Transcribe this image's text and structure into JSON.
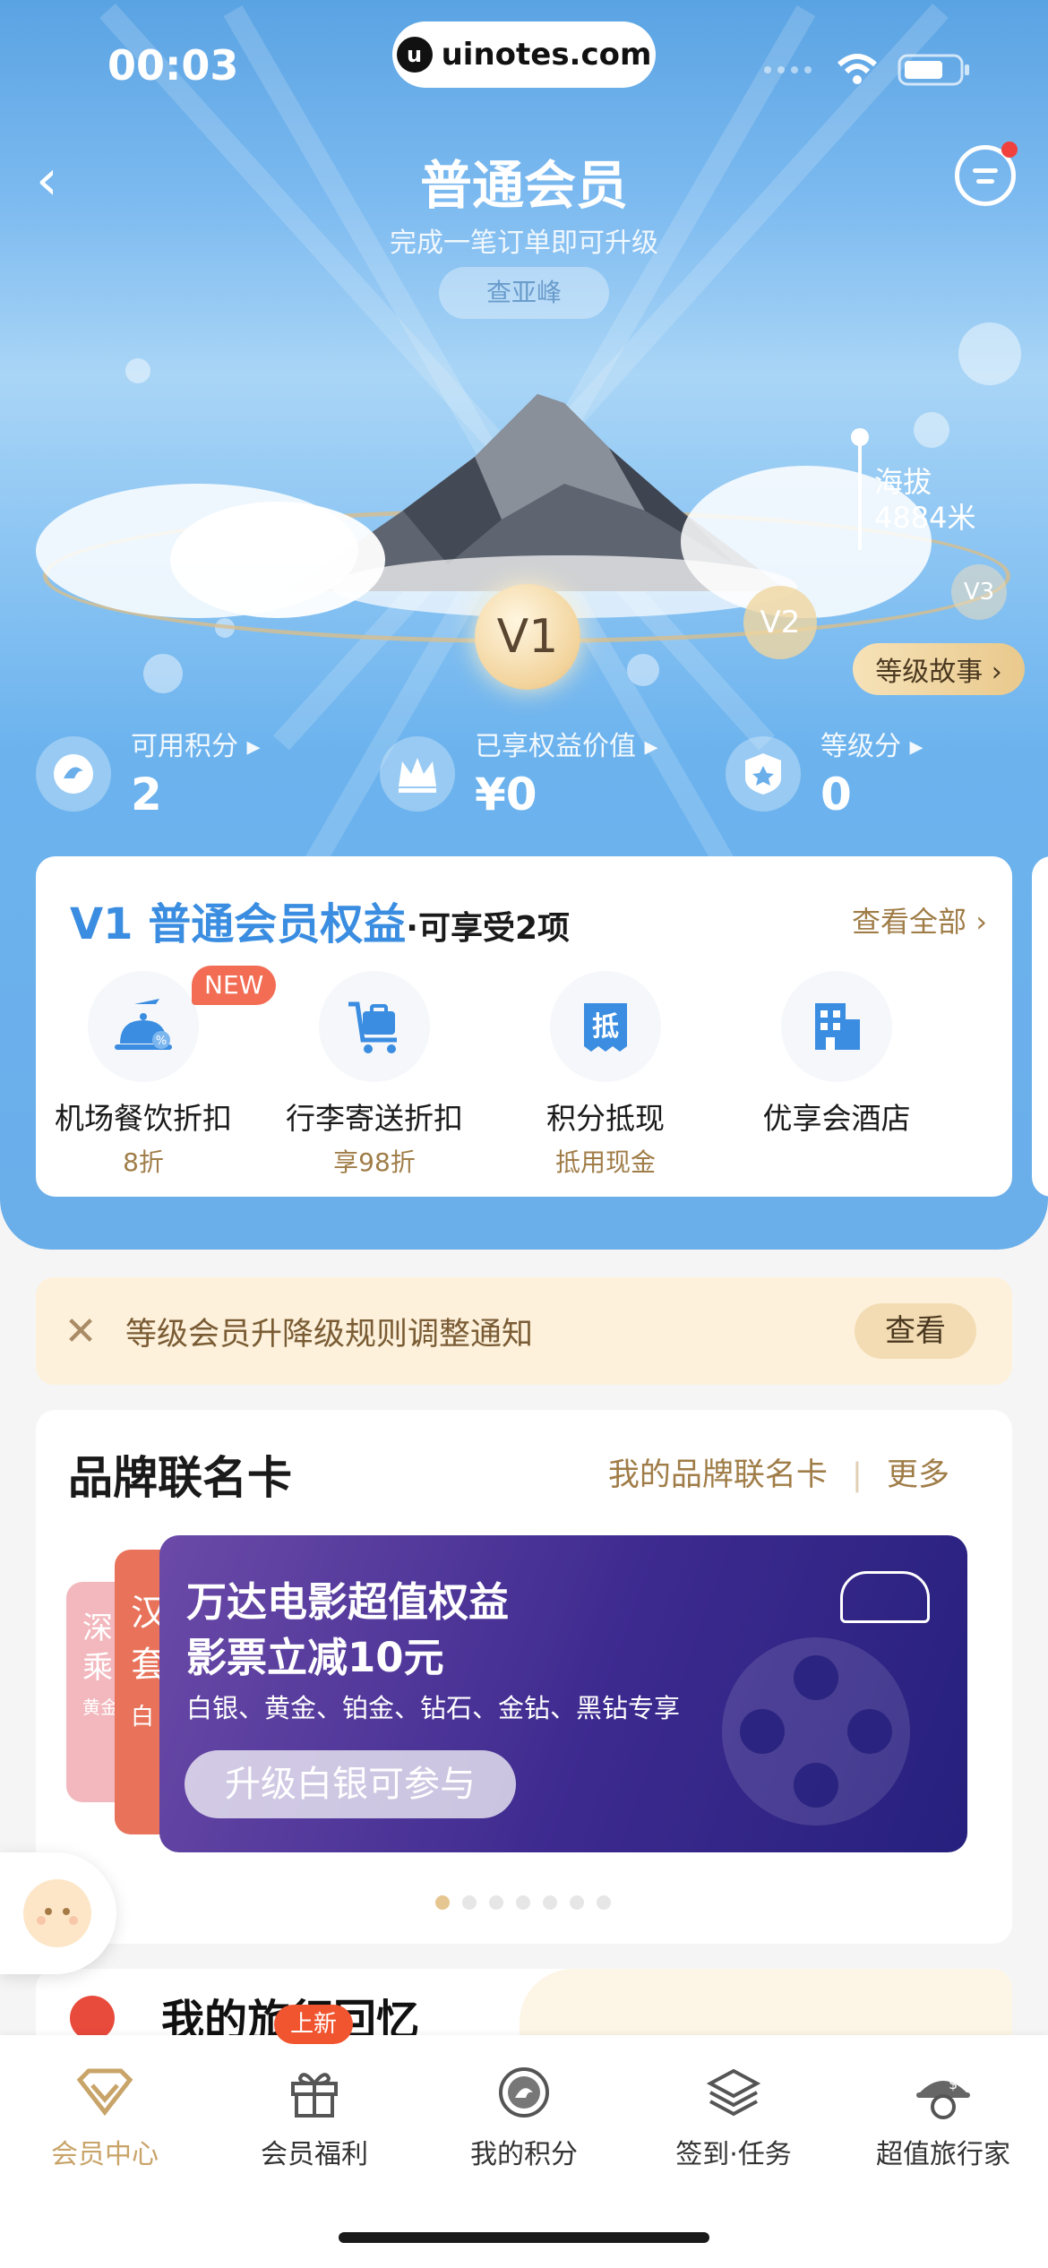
{
  "status": {
    "time": "00:03",
    "site": "uinotes.com",
    "site_icon": "u"
  },
  "header": {
    "title": "普通会员",
    "subtitle": "完成一笔订单即可升级",
    "location": "查亚峰"
  },
  "levels": {
    "current": "V1",
    "next": "V2",
    "later": "V3"
  },
  "altitude": {
    "label": "海拔",
    "value": "4884米"
  },
  "story_button": "等级故事 ›",
  "stats": [
    {
      "label": "可用积分 ▸",
      "value": "2",
      "icon": "points-icon"
    },
    {
      "label": "已享权益价值 ▸",
      "value": "¥0",
      "icon": "crown-icon"
    },
    {
      "label": "等级分 ▸",
      "value": "0",
      "icon": "badge-icon"
    }
  ],
  "benefits": {
    "title": "V1 普通会员权益",
    "count": "·可享受2项",
    "see_all": "查看全部 ›",
    "new_badge": "NEW",
    "items": [
      {
        "name": "机场餐饮折扣",
        "desc": "8折",
        "icon": "airport-dining-icon"
      },
      {
        "name": "行李寄送折扣",
        "desc": "享98折",
        "icon": "luggage-cart-icon"
      },
      {
        "name": "积分抵现",
        "desc": "抵用现金",
        "icon": "deduct-icon",
        "glyph": "抵"
      },
      {
        "name": "优享会酒店",
        "desc": "",
        "icon": "hotel-icon"
      }
    ]
  },
  "notice": {
    "text": "等级会员升降级规则调整通知",
    "button": "查看"
  },
  "brand": {
    "title": "品牌联名卡",
    "my_cards": "我的品牌联名卡",
    "more": "更多",
    "card": {
      "line1": "万达电影超值权益",
      "line2": "影票立减10元",
      "levels": "白银、黄金、铂金、钻石、金钻、黑钻专享",
      "cta": "升级白银可参与"
    },
    "back_cards": [
      {
        "l1": "深",
        "l2": "乘",
        "l3": "黄金"
      },
      {
        "l1": "汉",
        "l2": "套",
        "l3": "白"
      }
    ]
  },
  "memory": {
    "title": "我的旅行回忆"
  },
  "tabs": [
    {
      "label": "会员中心",
      "icon": "vip-diamond-icon",
      "active": true
    },
    {
      "label": "会员福利",
      "icon": "gift-icon",
      "active": false
    },
    {
      "label": "我的积分",
      "icon": "points-coin-icon",
      "active": false
    },
    {
      "label": "签到·任务",
      "icon": "layers-icon",
      "active": false
    },
    {
      "label": "超值旅行家",
      "icon": "traveler-icon",
      "active": false
    }
  ],
  "new_tag": "上新",
  "colors": {
    "accent_blue": "#3a8de0",
    "gold": "#a07d48",
    "tab_active": "#c8a469",
    "new_red": "#f26d54"
  }
}
